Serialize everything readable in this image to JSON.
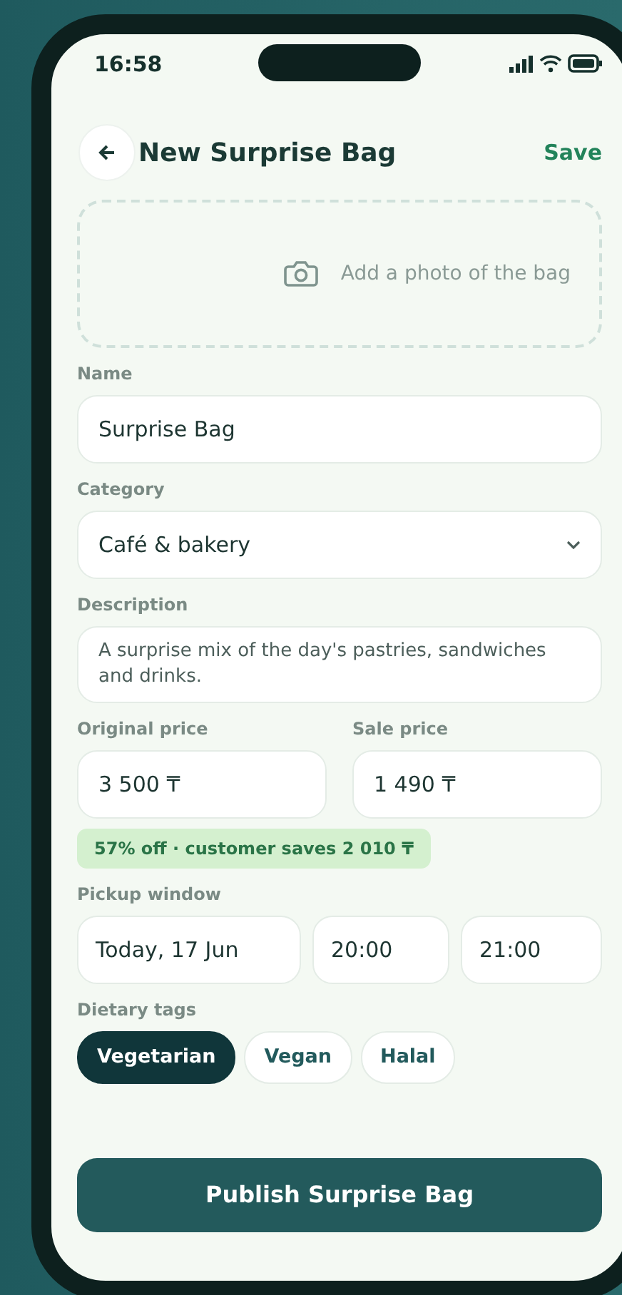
{
  "status_bar": {
    "time": "16:58"
  },
  "header": {
    "title": "New Surprise Bag",
    "action": "Save"
  },
  "photo": {
    "label": "Add a photo of the bag"
  },
  "name": {
    "label": "Name",
    "value": "Surprise Bag"
  },
  "category": {
    "label": "Category",
    "value": "Café & bakery"
  },
  "description": {
    "label": "Description",
    "value": "A surprise mix of the day's pastries, sandwiches and drinks."
  },
  "prices": [
    {
      "label": "Original price",
      "value": "3 500 ₸"
    },
    {
      "label": "Sale price",
      "value": "1 490 ₸"
    }
  ],
  "savings": "57% off · customer saves 2 010 ₸",
  "pickup": {
    "label": "Pickup window",
    "date": "Today, 17 Jun",
    "start": "20:00",
    "end": "21:00"
  },
  "dietary": {
    "label": "Dietary tags",
    "tags": [
      {
        "label": "Vegetarian",
        "selected": true
      },
      {
        "label": "Vegan",
        "selected": false
      },
      {
        "label": "Halal",
        "selected": false
      }
    ]
  },
  "publish_button": "Publish Surprise Bag"
}
